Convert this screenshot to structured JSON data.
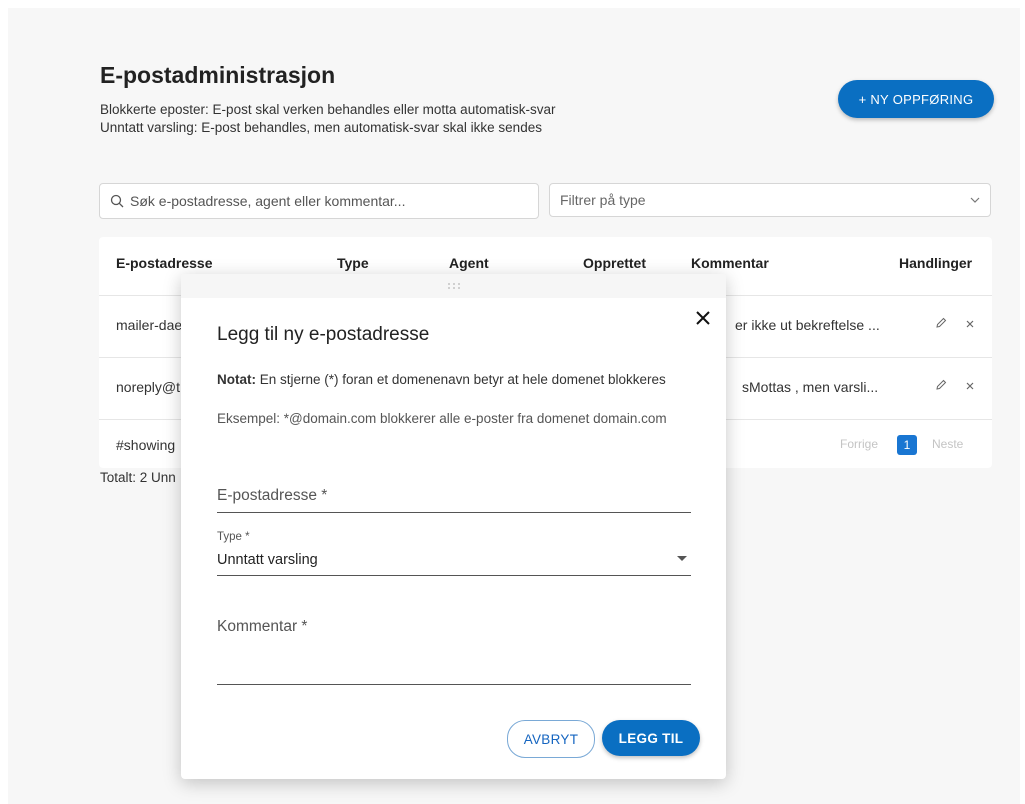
{
  "header": {
    "title": "E-postadministrasjon",
    "desc_line1": "Blokkerte eposter: E-post skal verken behandles eller motta automatisk-svar",
    "desc_line2": "Unntatt varsling: E-post behandles, men automatisk-svar skal ikke sendes",
    "new_button": "+ NY OPPFØRING"
  },
  "filters": {
    "search_placeholder": "Søk e-postadresse, agent eller kommentar...",
    "type_placeholder": "Filtrer på type"
  },
  "table": {
    "headers": [
      "E-postadresse",
      "Type",
      "Agent",
      "Opprettet",
      "Kommentar",
      "Handlinger"
    ],
    "rows": [
      {
        "email": "mailer-dae",
        "comment": "er ikke ut bekreftelse ..."
      },
      {
        "email": "noreply@t",
        "comment": "sMottas , men varsli..."
      }
    ],
    "footer_text": "#showing",
    "pager": {
      "prev": "Forrige",
      "page": "1",
      "next": "Neste"
    }
  },
  "total": "Totalt: 2 Unn",
  "modal": {
    "title": "Legg til ny e-postadresse",
    "note_label": "Notat:",
    "note_text": "En stjerne (*) foran et domenenavn betyr at hele domenet blokkeres",
    "example_text": "Eksempel: *@domain.com blokkerer alle e-poster fra domenet domain.com",
    "email_label": "E-postadresse *",
    "type_label": "Type *",
    "type_value": "Unntatt varsling",
    "comment_label": "Kommentar *",
    "cancel": "AVBRYT",
    "submit": "LEGG TIL"
  },
  "icons": {
    "search": "search-icon",
    "chevron": "chevron-down-icon",
    "edit": "pencil-icon",
    "delete": "close-icon",
    "drag": "drag-handle-icon",
    "close": "close-icon"
  },
  "colors": {
    "accent": "#0a6fc2",
    "pager_active": "#1976d2",
    "background": "#f7f7f7"
  }
}
